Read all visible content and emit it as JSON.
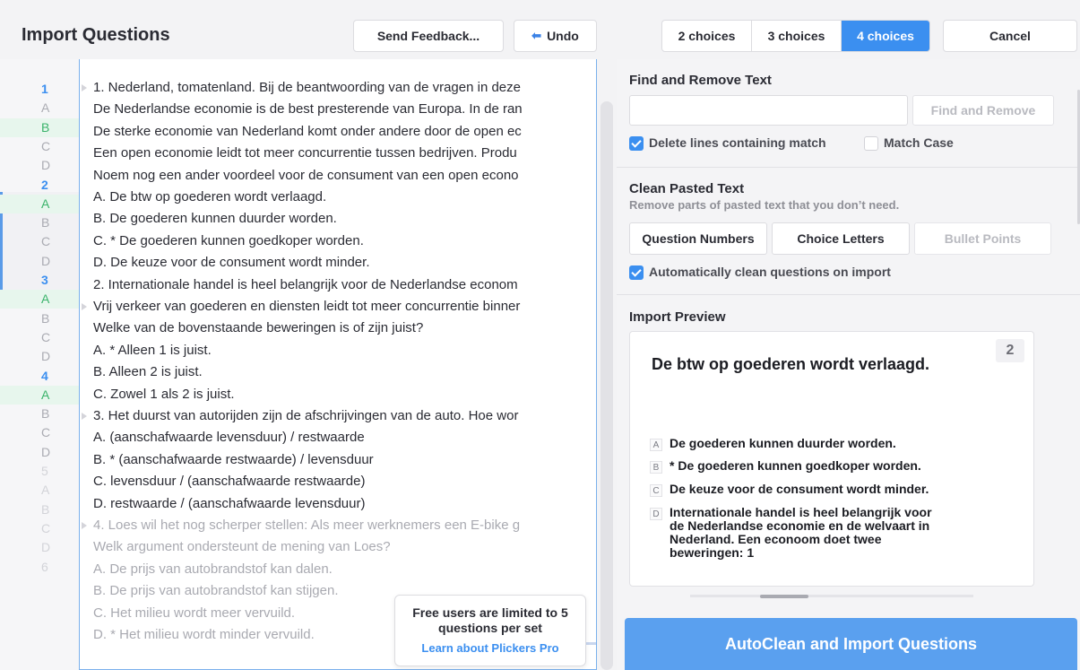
{
  "header": {
    "title": "Import Questions",
    "send_feedback": "Send Feedback...",
    "undo": "Undo",
    "choices": [
      "2 choices",
      "3 choices",
      "4 choices"
    ],
    "selected_choice": "4 choices",
    "cancel": "Cancel"
  },
  "editor": {
    "gutter": [
      "1",
      "A",
      "B",
      "C",
      "D",
      "2",
      "A",
      "B",
      "C",
      "D",
      "3",
      "A",
      "B",
      "C",
      "D",
      "4",
      "A",
      "B",
      "C",
      "D",
      "5",
      "A",
      "B",
      "C",
      "D",
      "6"
    ],
    "lines": [
      "1. Nederland, tomatenland. Bij de beantwoording van de vragen in deze",
      "De Nederlandse economie is de best presterende van Europa. In de ran",
      "De sterke economie van Nederland komt onder andere door de open ec",
      "Een open economie leidt tot meer concurrentie tussen bedrijven. Produ",
      "Noem nog een ander voordeel voor de consument van een open econo",
      "A. De btw op goederen wordt verlaagd.",
      "B. De goederen kunnen duurder worden.",
      "C. * De goederen kunnen goedkoper worden.",
      "D. De keuze voor de consument wordt minder.",
      "2. Internationale handel is heel belangrijk voor de Nederlandse econom",
      "Vrij verkeer van goederen en diensten leidt tot meer concurrentie binner",
      "Welke van de bovenstaande beweringen is of zijn juist?",
      "A. * Alleen 1 is juist.",
      "B. Alleen 2 is juist.",
      "C. Zowel 1 als 2 is juist.",
      "3. Het duurst van autorijden zijn de afschrijvingen van de auto. Hoe wor",
      "A. (aanschafwaarde   levensduur) / restwaarde",
      "B. * (aanschafwaarde   restwaarde) / levensduur",
      "C. levensduur / (aanschafwaarde   restwaarde)",
      "D. restwaarde / (aanschafwaarde   levensduur)",
      "4. Loes wil het nog scherper stellen:  Als meer werknemers een E-bike g",
      "Welk argument ondersteunt de mening van Loes?",
      "A. De prijs van autobrandstof kan dalen.",
      "B. De prijs van autobrandstof kan stijgen.",
      "C. Het milieu wordt meer vervuild.",
      "D. * Het milieu wordt minder vervuild."
    ]
  },
  "tooltip": {
    "line1": "Free users are limited to 5",
    "line2": "questions per set",
    "link": "Learn about Plickers Pro"
  },
  "find": {
    "title": "Find and Remove Text",
    "input_value": "",
    "button": "Find and Remove",
    "delete_lines_label": "Delete lines containing match",
    "delete_lines_checked": true,
    "match_case_label": "Match Case",
    "match_case_checked": false
  },
  "clean": {
    "title": "Clean Pasted Text",
    "subtitle": "Remove parts of pasted text that you don’t need.",
    "buttons": [
      "Question Numbers",
      "Choice Letters",
      "Bullet Points"
    ],
    "auto_label": "Automatically clean questions on import",
    "auto_checked": true
  },
  "preview": {
    "title": "Import Preview",
    "number": "2",
    "question": "De btw op goederen wordt verlaagd.",
    "choices": [
      {
        "letter": "A",
        "text": "De goederen kunnen duurder worden."
      },
      {
        "letter": "B",
        "text": "* De goederen kunnen goedkoper worden."
      },
      {
        "letter": "C",
        "text": "De keuze voor de consument wordt minder."
      },
      {
        "letter": "D",
        "text": "Internationale handel is heel belangrijk voor de Nederlandse economie en de welvaart in Nederland. Een econoom doet twee beweringen: 1"
      }
    ]
  },
  "import_button": "AutoClean and Import Questions",
  "colors": {
    "accent": "#3b8ff0",
    "answer_green": "#3bb36b",
    "import_button": "#5aa0ef"
  }
}
